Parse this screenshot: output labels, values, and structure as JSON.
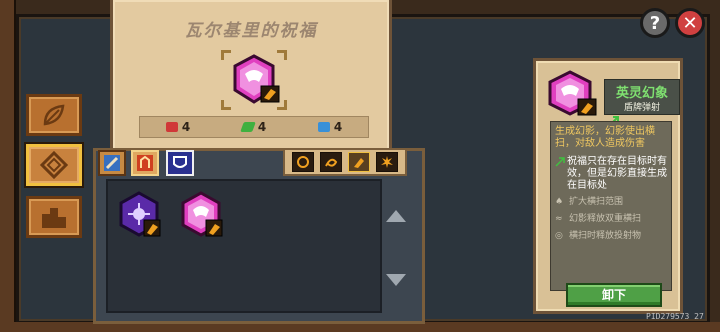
{
  "blessing": {
    "title": "瓦尔基里的祝福",
    "stats": [
      {
        "icon": "red-gem-icon",
        "value": "4",
        "color": "#e04040"
      },
      {
        "icon": "green-leaf-icon",
        "value": "4",
        "color": "#40c040"
      },
      {
        "icon": "blue-card-icon",
        "value": "4",
        "color": "#40a0e0"
      }
    ]
  },
  "top_buttons": {
    "help": "?",
    "close": "✕"
  },
  "side_nav": [
    {
      "name": "side-nav-leaf",
      "icon": "leaf-icon",
      "active": false
    },
    {
      "name": "side-nav-diamond",
      "icon": "diamond-frame-icon",
      "active": true
    },
    {
      "name": "side-nav-podium",
      "icon": "podium-icon",
      "active": false
    }
  ],
  "tabs": [
    {
      "name": "tab-weapon",
      "icon": "sword-icon",
      "active": false
    },
    {
      "name": "tab-skill",
      "icon": "skill-icon",
      "active": true
    },
    {
      "name": "tab-shield",
      "icon": "shield-icon",
      "active": false
    }
  ],
  "filters": [
    {
      "name": "filter-1",
      "icon": "flame-ring-icon",
      "active": false
    },
    {
      "name": "filter-2",
      "icon": "flame-swirl-icon",
      "active": false
    },
    {
      "name": "filter-3",
      "icon": "flame-bolt-icon",
      "active": true
    },
    {
      "name": "filter-4",
      "icon": "flame-burst-icon",
      "active": false
    }
  ],
  "detail": {
    "skill_name": "英灵幻象",
    "skill_sub": "盾牌弹射",
    "description": "生成幻影，幻影使出横扫，对敌人造成伤害",
    "bullet": "祝福只在存在目标时有效，但是幻影直接生成在目标处",
    "upgrades": [
      "扩大横扫范围",
      "幻影释放双重横扫",
      "横扫时释放投射物"
    ],
    "unequip_label": "卸下"
  },
  "footer": {
    "pid": "PID279573  27"
  },
  "colors": {
    "accent_green": "#7fe070",
    "accent_gold": "#f0c860",
    "parchment": "#e3caa0"
  }
}
